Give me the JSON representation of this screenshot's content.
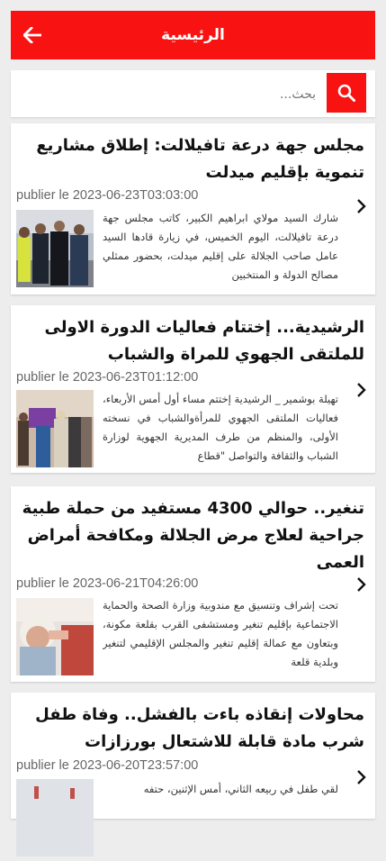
{
  "header": {
    "title": "الرئيسية"
  },
  "search": {
    "placeholder": "بحث..."
  },
  "articles": [
    {
      "title": "مجلس جهة درعة تافيلالت: إطلاق مشاريع تنموية بإقليم ميدلت",
      "date": "publier le 2023-06-23T03:03:00",
      "excerpt": "شارك السيد مولاي ابراهيم الكبير، كاتب مجلس جهة درعة تافيلالت، اليوم الخميس، في زيارة قادها السيد عامل صاحب الجلالة على إقليم ميدلت، بحضور ممثلي مصالح الدولة و المنتخبين"
    },
    {
      "title": "الرشيدية... إختتام فعاليات الدورة الاولى للملتقى الجهوي للمراة والشباب",
      "date": "publier le 2023-06-23T01:12:00",
      "excerpt": "تهيلة بوشمير _ الرشيدية إختتم مساء أول أمس الأربعاء، فعاليات الملتقى الجهوي للمرأةوالشباب في نسخته الأولى، والمنظم من طرف المديرية الجهوية لوزارة الشباب والثقافة والتواصل \"قطاع"
    },
    {
      "title": "تنغير.. حوالي 4300 مستفيد من حملة طبية جراحية لعلاج مرض الجلالة ومكافحة أمراض العمى",
      "date": "publier le 2023-06-21T04:26:00",
      "excerpt": "تحت إشراف وتنسيق مع مندوبية وزارة الصحة والحماية الاجتماعية بإقليم تنغير ومستشفى القرب بقلعة مكونة، وبتعاون مع عمالة إقليم تنغير والمجلس الإقليمي لتنغير وبلدية قلعة"
    },
    {
      "title": "محاولات إنقاذه باءت بالفشل.. وفاة طفل شرب مادة قابلة للاشتعال بورزازات",
      "date": "publier le 2023-06-20T23:57:00",
      "excerpt": "لقي طفل في ربيعه الثاني، أمس الإثنين، حتفه"
    }
  ],
  "colors": {
    "accent": "#f81212",
    "background": "#ededed"
  }
}
